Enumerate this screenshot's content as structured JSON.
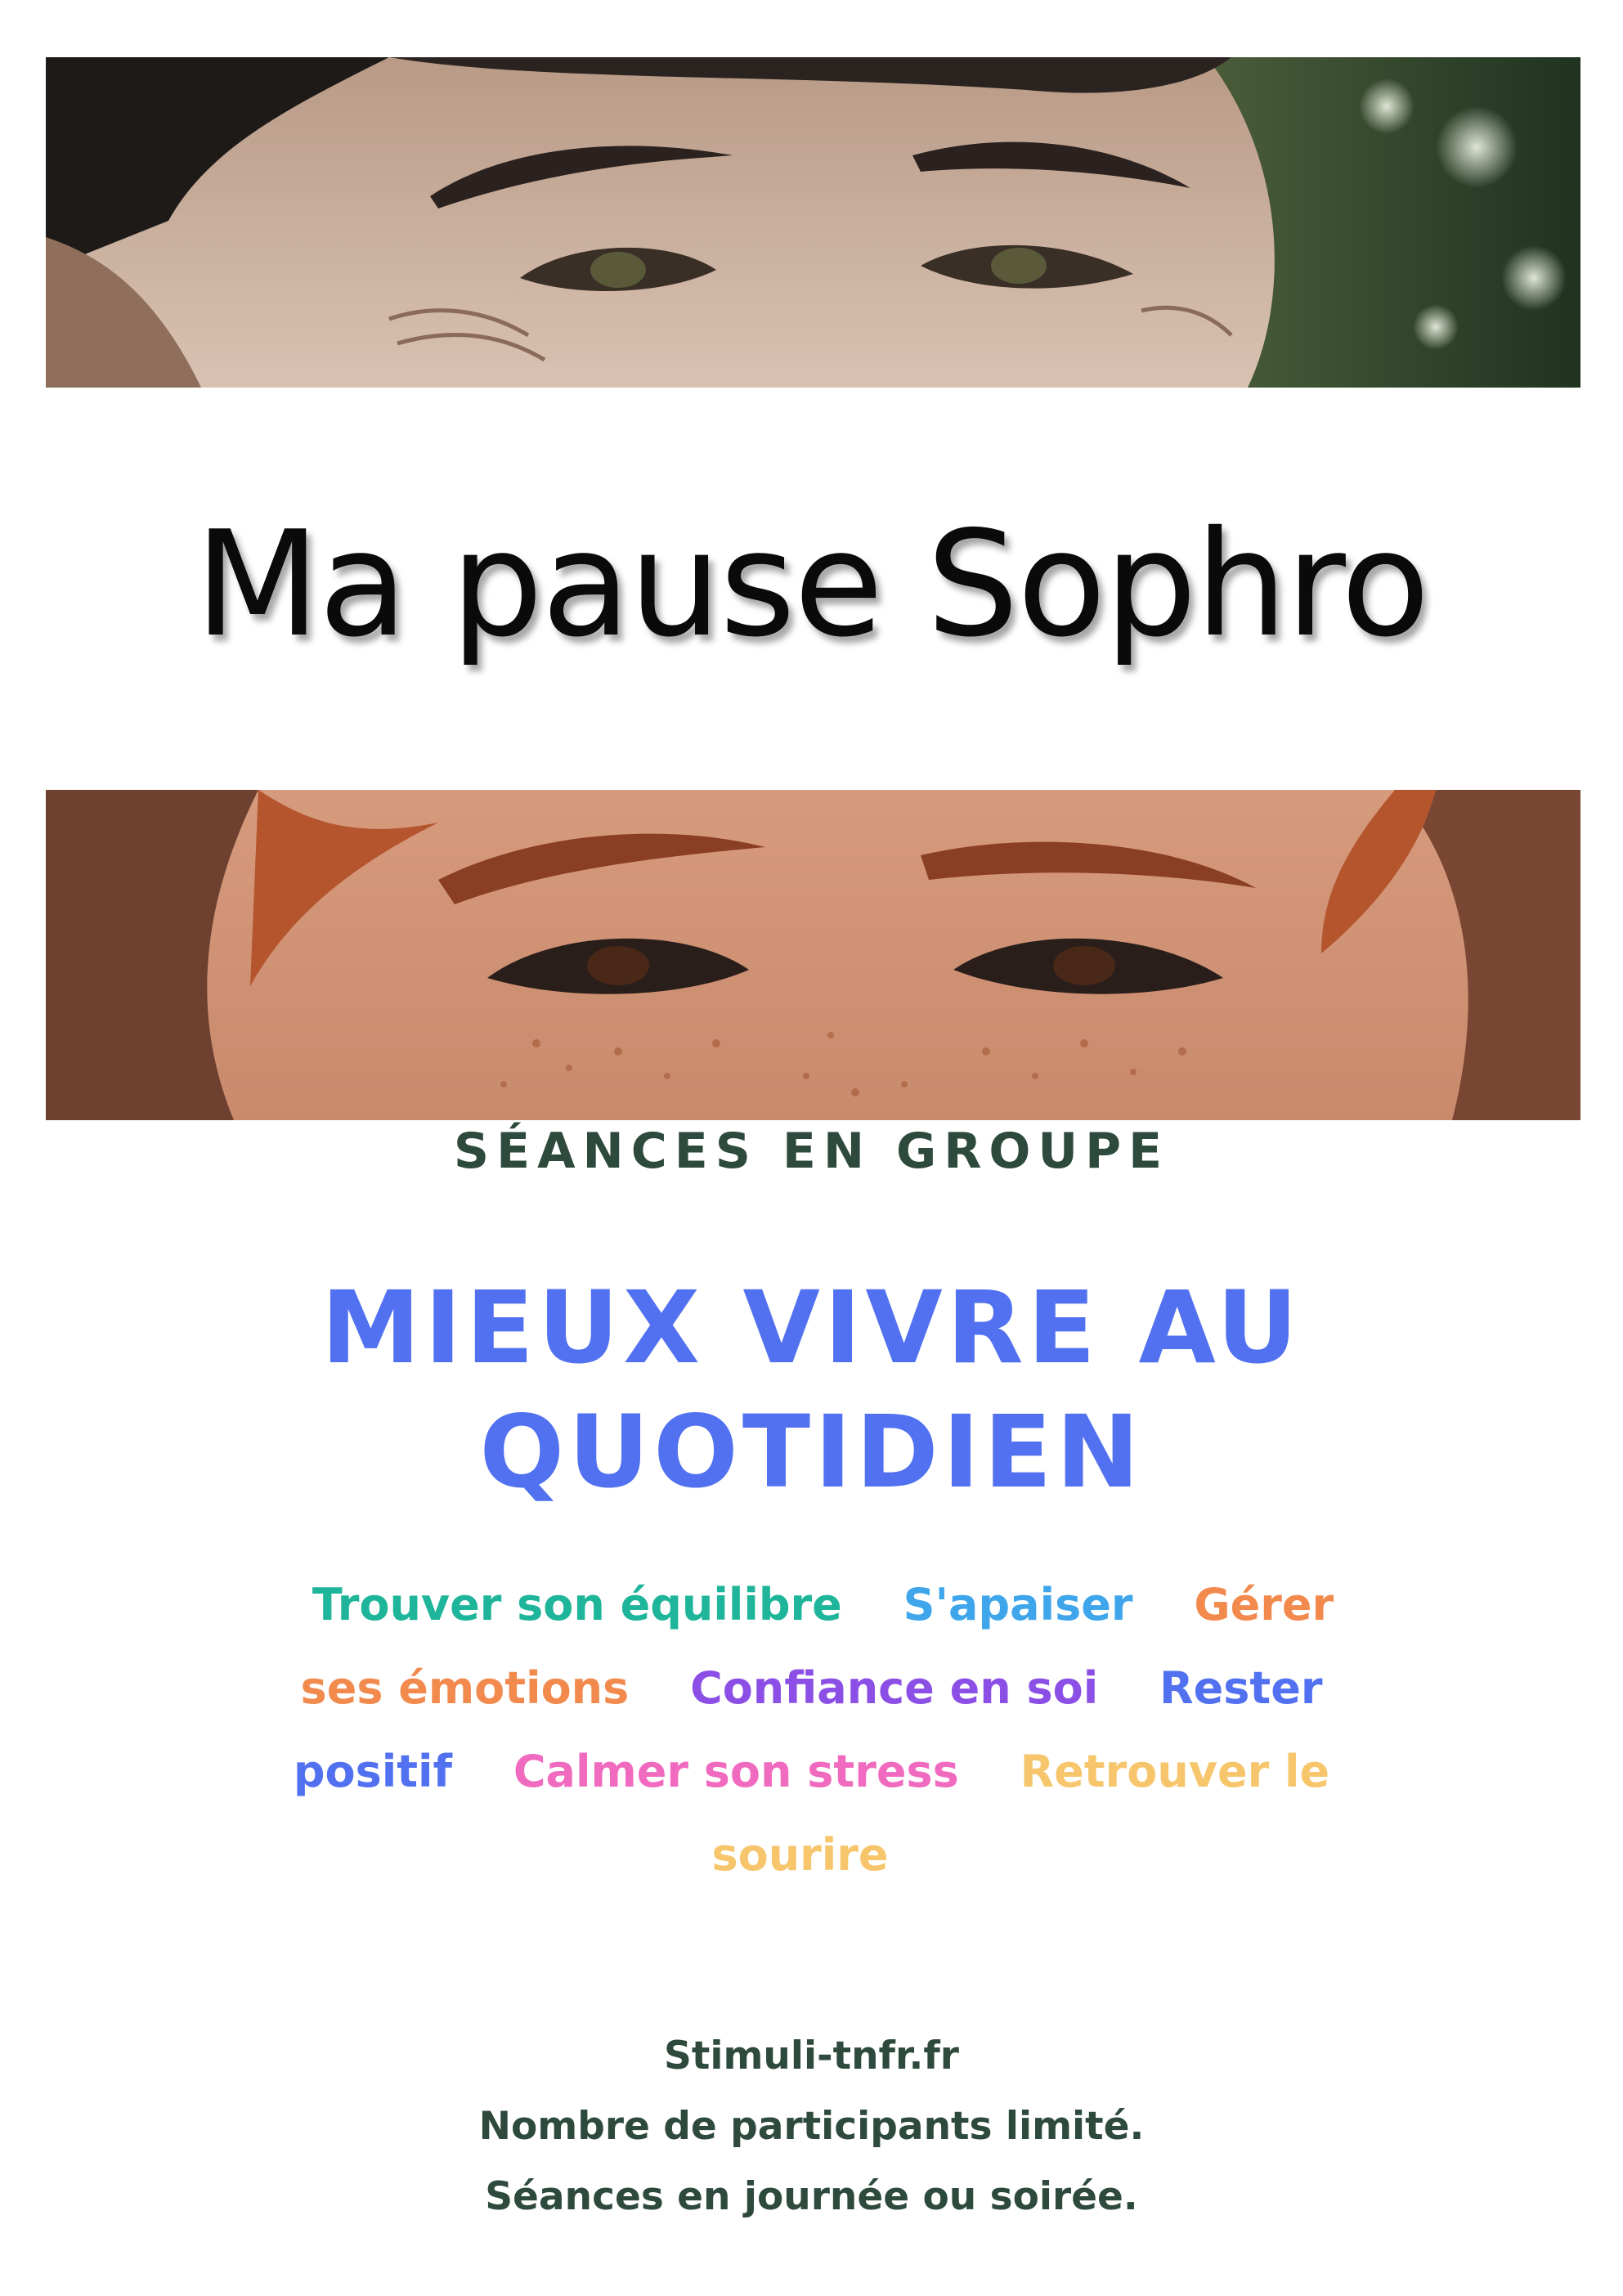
{
  "title": "Ma pause Sophro",
  "section_label": "SÉANCES EN GROUPE",
  "headline": {
    "line1": "MIEUX VIVRE AU",
    "line2": "QUOTIDIEN"
  },
  "keywords": [
    {
      "text": "Trouver son équilibre",
      "color": "#1fb59a"
    },
    {
      "text": "S'apaiser",
      "color": "#3fa6ec"
    },
    {
      "text_part1": "Gérer",
      "text_part2": "ses émotions",
      "color": "#f28a4e"
    },
    {
      "text": "Confiance en soi",
      "color": "#8c4fe6"
    },
    {
      "text_part1": "Rester",
      "text_part2": "positif",
      "color": "#5271f0"
    },
    {
      "text": "Calmer son stress",
      "color": "#f06bbf"
    },
    {
      "text_part1": "Retrouver le",
      "text_part2": "sourire",
      "color": "#f7c56b"
    }
  ],
  "footer": {
    "website": "Stimuli-tnfr.fr",
    "line2": "Nombre de participants limité.",
    "line3": "Séances en journée ou soirée."
  },
  "images": {
    "top": "photo of a smiling person's eyes with green blurred foliage background",
    "bottom": "photo of a freckled woman's eyes with red hair"
  }
}
